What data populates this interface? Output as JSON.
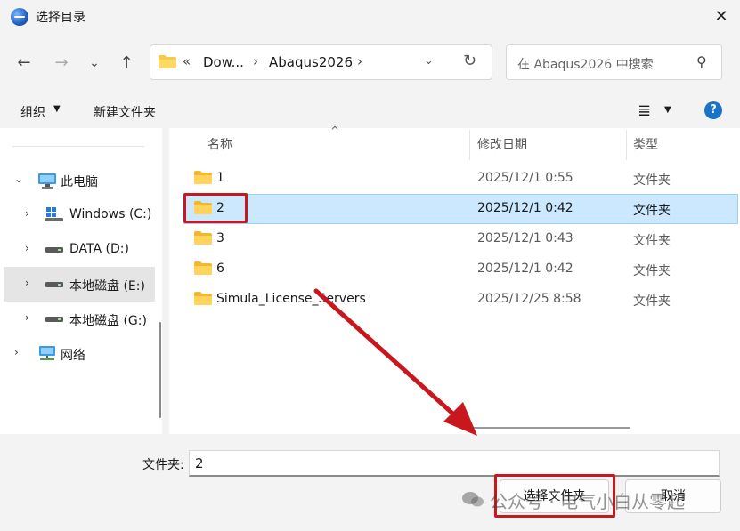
{
  "window": {
    "title": "选择目录",
    "close_glyph": "✕"
  },
  "nav": {
    "back_glyph": "←",
    "forward_glyph": "→",
    "recent_glyph": "⌄",
    "up_glyph": "↑",
    "breadcrumbs": [
      "«",
      "Dow...",
      "›",
      "Abaqus2026",
      "›"
    ],
    "dropdown_glyph": "⌄",
    "refresh_glyph": "↻",
    "search_placeholder": "在 Abaqus2026 中搜索",
    "search_glyph": "⚲"
  },
  "toolbar": {
    "organize": "组织",
    "organize_caret": "▼",
    "new_folder": "新建文件夹",
    "view_glyph": "≣",
    "view_caret": "▼",
    "help_glyph": "?"
  },
  "sidebar": {
    "items": [
      {
        "label": "此电脑",
        "chevron": "⌄",
        "icon": "computer-icon"
      },
      {
        "label": "Windows (C:)",
        "chevron": "›",
        "icon": "windows-drive-icon"
      },
      {
        "label": "DATA (D:)",
        "chevron": "›",
        "icon": "drive-icon"
      },
      {
        "label": "本地磁盘 (E:)",
        "chevron": "›",
        "icon": "drive-icon"
      },
      {
        "label": "本地磁盘 (G:)",
        "chevron": "›",
        "icon": "drive-icon"
      },
      {
        "label": "网络",
        "chevron": "›",
        "icon": "network-icon"
      }
    ]
  },
  "list": {
    "columns": {
      "name": "名称",
      "modified": "修改日期",
      "type": "类型"
    },
    "sort_glyph": "^",
    "rows": [
      {
        "name": "1",
        "modified": "2025/12/1 0:55",
        "type": "文件夹"
      },
      {
        "name": "2",
        "modified": "2025/12/1 0:42",
        "type": "文件夹"
      },
      {
        "name": "3",
        "modified": "2025/12/1 0:43",
        "type": "文件夹"
      },
      {
        "name": "6",
        "modified": "2025/12/1 0:42",
        "type": "文件夹"
      },
      {
        "name": "Simula_License_Servers",
        "modified": "2025/12/25 8:58",
        "type": "文件夹"
      }
    ],
    "selected_index": 1
  },
  "footer": {
    "folder_label": "文件夹:",
    "folder_value": "2",
    "select_button": "选择文件夹",
    "cancel_button": "取消"
  },
  "watermark": {
    "text": "公众号 · 电气小白从零起"
  },
  "colors": {
    "annotation_red": "#c8181e",
    "selection": "#cce8ff",
    "folder": "#f8c94a"
  }
}
